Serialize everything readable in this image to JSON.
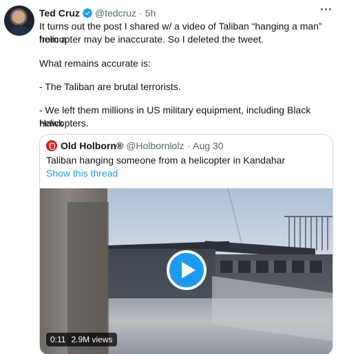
{
  "tweet": {
    "author_name": "Ted Cruz",
    "author_handle": "@tedcruz",
    "separator": "·",
    "time": "5h",
    "lines": [
      "It turns out the post I shared w/ a video of Taliban “hanging a man” from a",
      "helicopter may be inaccurate. So I deleted the tweet.",
      "What remains accurate is:",
      "- The Taliban are brutal terrorists.",
      "- We left them millions in US military equipment, including Black Hawk",
      "helicopters."
    ]
  },
  "quoted": {
    "author_name": "Old Holborn®",
    "author_handle": "@Holbornlolz",
    "separator": "·",
    "date": "Aug 30",
    "text": "Taliban hanging someone from a helicopter in Kandahar",
    "show_thread": "Show this thread",
    "video": {
      "duration": "0:11",
      "views": "2.9M views"
    }
  },
  "colors": {
    "accent": "#1d9bf0",
    "text_primary": "#0f1419",
    "text_secondary": "#536471",
    "border": "#cfd9de"
  },
  "icons": [
    "verified-badge-icon",
    "more-icon",
    "play-icon"
  ]
}
